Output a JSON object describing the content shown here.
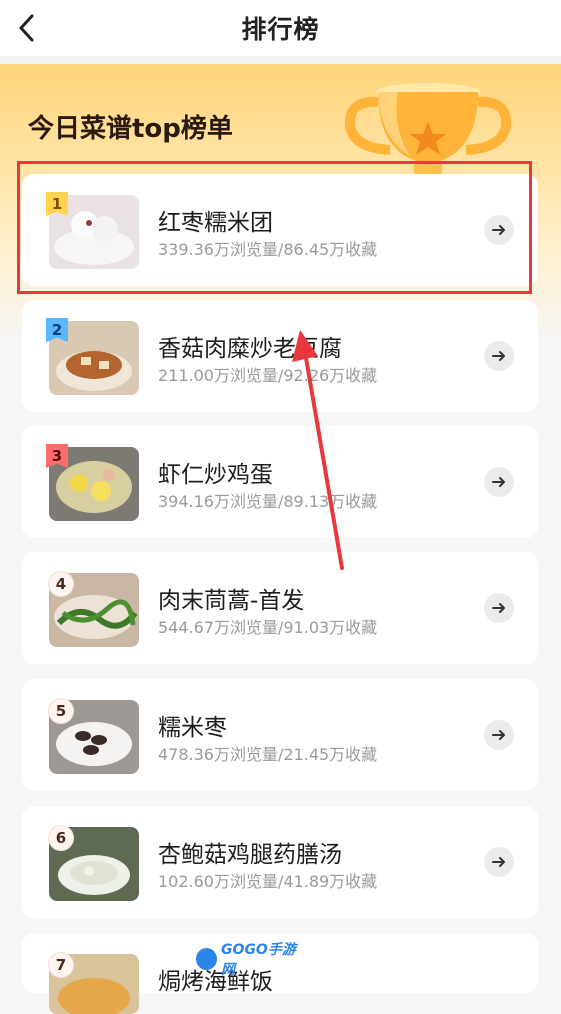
{
  "header": {
    "title": "排行榜",
    "back_icon": "chevron-left-icon"
  },
  "hero": {
    "title": "今日菜谱top榜单",
    "trophy_icon": "trophy-icon"
  },
  "list": [
    {
      "rank": "1",
      "name": "红枣糯米团",
      "stats": "339.36万浏览量/86.45万收藏",
      "badge_color": "#ffd34d"
    },
    {
      "rank": "2",
      "name": "香菇肉糜炒老豆腐",
      "stats": "211.00万浏览量/92.26万收藏",
      "badge_color": "#5ab6ff"
    },
    {
      "rank": "3",
      "name": "虾仁炒鸡蛋",
      "stats": "394.16万浏览量/89.13万收藏",
      "badge_color": "#ff6b6b"
    },
    {
      "rank": "4",
      "name": "肉末茼蒿-首发",
      "stats": "544.67万浏览量/91.03万收藏"
    },
    {
      "rank": "5",
      "name": "糯米枣",
      "stats": "478.36万浏览量/21.45万收藏"
    },
    {
      "rank": "6",
      "name": "杏鲍菇鸡腿药膳汤",
      "stats": "102.60万浏览量/41.89万收藏"
    },
    {
      "rank": "7",
      "name": "焗烤海鲜饭",
      "stats": ""
    }
  ],
  "watermark": {
    "text": "GOGO手游网"
  },
  "colors": {
    "highlight": "#e8383d",
    "hero_gradient_top": "#ffd479"
  }
}
